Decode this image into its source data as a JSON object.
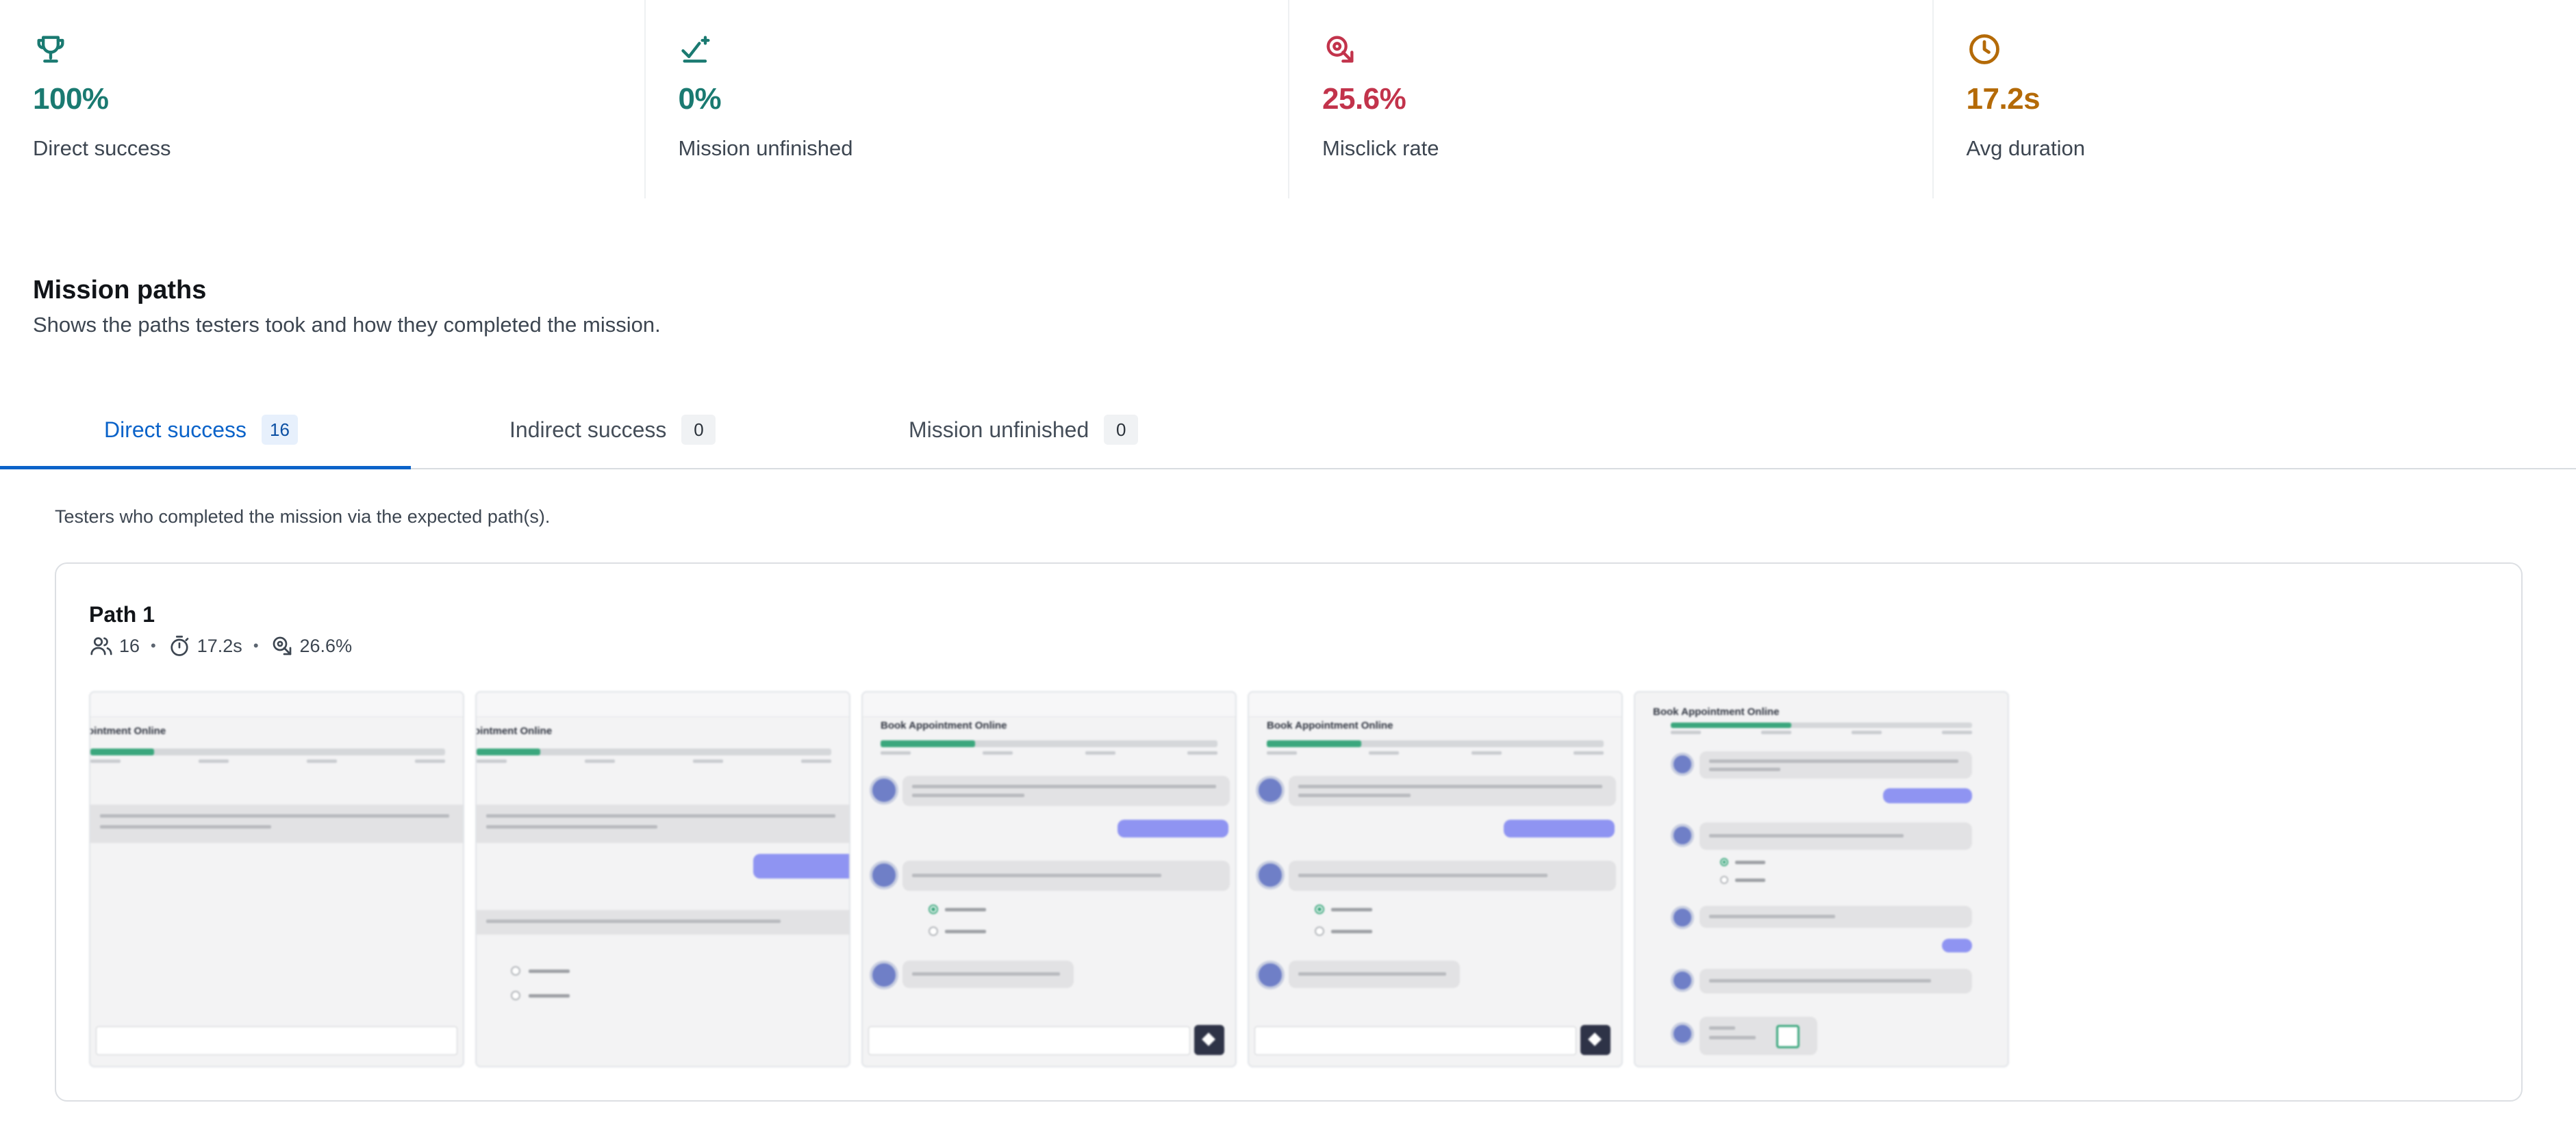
{
  "stats": [
    {
      "value": "100%",
      "label": "Direct success",
      "icon": "trophy-icon",
      "color": "#1a7a71"
    },
    {
      "value": "0%",
      "label": "Mission unfinished",
      "icon": "unfinished-icon",
      "color": "#1a7a71"
    },
    {
      "value": "25.6%",
      "label": "Misclick rate",
      "icon": "misclick-icon",
      "color": "#c2334b"
    },
    {
      "value": "17.2s",
      "label": "Avg duration",
      "icon": "clock-icon",
      "color": "#b46a07"
    }
  ],
  "section": {
    "title": "Mission paths",
    "subtitle": "Shows the paths testers took and how they completed the mission."
  },
  "tabs": [
    {
      "label": "Direct success",
      "count": "16",
      "active": true
    },
    {
      "label": "Indirect success",
      "count": "0",
      "active": false
    },
    {
      "label": "Mission unfinished",
      "count": "0",
      "active": false
    }
  ],
  "tab_description": "Testers who completed the mission via the expected path(s).",
  "path": {
    "title": "Path 1",
    "testers": "16",
    "duration": "17.2s",
    "misclick": "26.6%",
    "separator": "•"
  },
  "screenshots": [
    {
      "heading": "ointment Online"
    },
    {
      "heading": "ointment Online"
    },
    {
      "heading": "Book Appointment Online"
    },
    {
      "heading": "Book Appointment Online"
    },
    {
      "heading": "Book Appointment Online"
    }
  ],
  "colors": {
    "accent": "#0b63c9",
    "success": "#1a7a71",
    "danger": "#c2334b",
    "warning": "#b46a07"
  }
}
